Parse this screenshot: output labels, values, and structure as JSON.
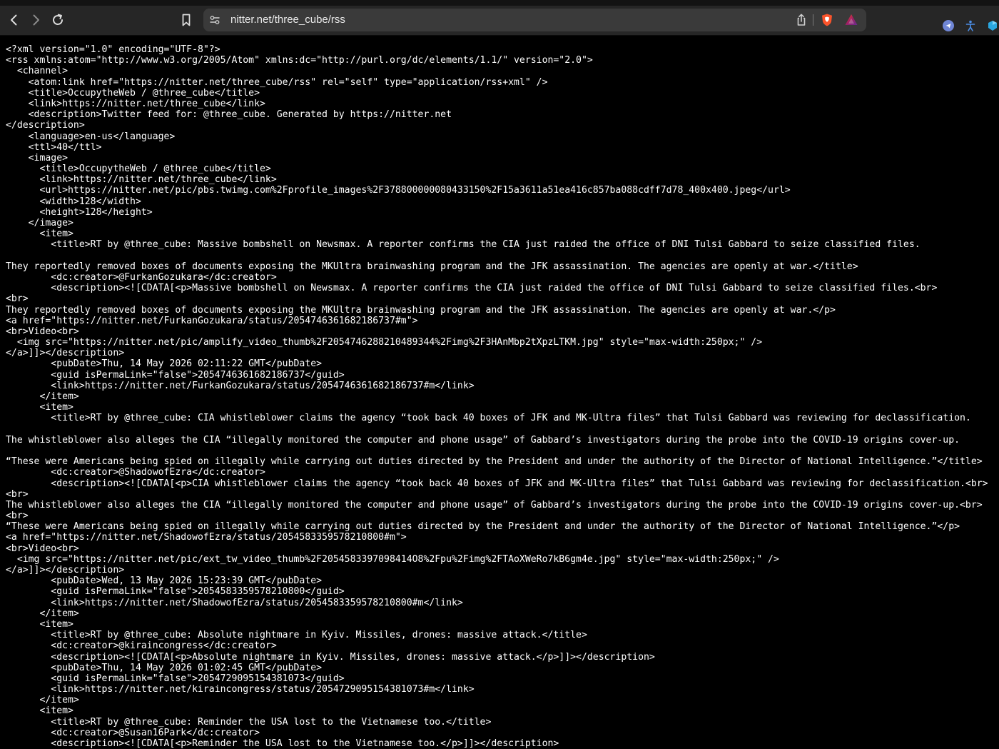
{
  "browser": {
    "url": "nitter.net/three_cube/rss",
    "icons": {
      "back": "back-arrow-icon",
      "forward": "forward-arrow-icon",
      "reload": "reload-icon",
      "bookmark": "bookmark-icon",
      "site_settings": "site-settings-icon",
      "share": "share-icon",
      "shields": "brave-shields-icon",
      "rewards": "brave-rewards-icon",
      "ext1": "extension-icon",
      "ext2": "accessibility-icon",
      "ext3": "puzzle-icon"
    },
    "colors": {
      "toolbar": "#262626",
      "address_bar": "#3a3a3a",
      "page_background": "#000000",
      "text": "#ffffff",
      "shields": "#fb542b",
      "rewards_gradient": [
        "#ff4724",
        "#9e1f63",
        "#662d91"
      ]
    }
  },
  "xml_lines": [
    "<?xml version=\"1.0\" encoding=\"UTF-8\"?>",
    "<rss xmlns:atom=\"http://www.w3.org/2005/Atom\" xmlns:dc=\"http://purl.org/dc/elements/1.1/\" version=\"2.0\">",
    "  <channel>",
    "    <atom:link href=\"https://nitter.net/three_cube/rss\" rel=\"self\" type=\"application/rss+xml\" />",
    "    <title>OccupytheWeb / @three_cube</title>",
    "    <link>https://nitter.net/three_cube</link>",
    "    <description>Twitter feed for: @three_cube. Generated by https://nitter.net",
    "</description>",
    "    <language>en-us</language>",
    "    <ttl>40</ttl>",
    "    <image>",
    "      <title>OccupytheWeb / @three_cube</title>",
    "      <link>https://nitter.net/three_cube</link>",
    "      <url>https://nitter.net/pic/pbs.twimg.com%2Fprofile_images%2F378800000080433150%2F15a3611a51ea416c857ba088cdff7d78_400x400.jpeg</url>",
    "      <width>128</width>",
    "      <height>128</height>",
    "    </image>",
    "      <item>",
    "        <title>RT by @three_cube: Massive bombshell on Newsmax. A reporter confirms the CIA just raided the office of DNI Tulsi Gabbard to seize classified files.",
    "",
    "They reportedly removed boxes of documents exposing the MKUltra brainwashing program and the JFK assassination. The agencies are openly at war.</title>",
    "        <dc:creator>@FurkanGozukara</dc:creator>",
    "        <description><![CDATA[<p>Massive bombshell on Newsmax. A reporter confirms the CIA just raided the office of DNI Tulsi Gabbard to seize classified files.<br>",
    "<br>",
    "They reportedly removed boxes of documents exposing the MKUltra brainwashing program and the JFK assassination. The agencies are openly at war.</p>",
    "<a href=\"https://nitter.net/FurkanGozukara/status/2054746361682186737#m\">",
    "<br>Video<br>",
    "  <img src=\"https://nitter.net/pic/amplify_video_thumb%2F2054746288210489344%2Fimg%2F3HAnMbp2tXpzLTKM.jpg\" style=\"max-width:250px;\" />",
    "</a>]]></description>",
    "        <pubDate>Thu, 14 May 2026 02:11:22 GMT</pubDate>",
    "        <guid isPermaLink=\"false\">2054746361682186737</guid>",
    "        <link>https://nitter.net/FurkanGozukara/status/2054746361682186737#m</link>",
    "      </item>",
    "      <item>",
    "        <title>RT by @three_cube: CIA whistleblower claims the agency “took back 40 boxes of JFK and MK-Ultra files” that Tulsi Gabbard was reviewing for declassification.",
    "",
    "The whistleblower also alleges the CIA “illegally monitored the computer and phone usage” of Gabbard’s investigators during the probe into the COVID-19 origins cover-up.",
    "",
    "“These were Americans being spied on illegally while carrying out duties directed by the President and under the authority of the Director of National Intelligence.”</title>",
    "        <dc:creator>@ShadowofEzra</dc:creator>",
    "        <description><![CDATA[<p>CIA whistleblower claims the agency “took back 40 boxes of JFK and MK-Ultra files” that Tulsi Gabbard was reviewing for declassification.<br>",
    "<br>",
    "The whistleblower also alleges the CIA “illegally monitored the computer and phone usage” of Gabbard’s investigators during the probe into the COVID-19 origins cover-up.<br>",
    "<br>",
    "“These were Americans being spied on illegally while carrying out duties directed by the President and under the authority of the Director of National Intelligence.”</p>",
    "<a href=\"https://nitter.net/ShadowofEzra/status/2054583359578210800#m\">",
    "<br>Video<br>",
    "  <img src=\"https://nitter.net/pic/ext_tw_video_thumb%2F2054583397098414O8%2Fpu%2Fimg%2FTAoXWeRo7kB6gm4e.jpg\" style=\"max-width:250px;\" />",
    "</a>]]></description>",
    "        <pubDate>Wed, 13 May 2026 15:23:39 GMT</pubDate>",
    "        <guid isPermaLink=\"false\">2054583359578210800</guid>",
    "        <link>https://nitter.net/ShadowofEzra/status/2054583359578210800#m</link>",
    "      </item>",
    "      <item>",
    "        <title>RT by @three_cube: Absolute nightmare in Kyiv. Missiles, drones: massive attack.</title>",
    "        <dc:creator>@kiraincongress</dc:creator>",
    "        <description><![CDATA[<p>Absolute nightmare in Kyiv. Missiles, drones: massive attack.</p>]]></description>",
    "        <pubDate>Thu, 14 May 2026 01:02:45 GMT</pubDate>",
    "        <guid isPermaLink=\"false\">2054729095154381073</guid>",
    "        <link>https://nitter.net/kiraincongress/status/2054729095154381073#m</link>",
    "      </item>",
    "      <item>",
    "        <title>RT by @three_cube: Reminder the USA lost to the Vietnamese too.</title>",
    "        <dc:creator>@Susan16Park</dc:creator>",
    "        <description><![CDATA[<p>Reminder the USA lost to the Vietnamese too.</p>]]></description>"
  ]
}
